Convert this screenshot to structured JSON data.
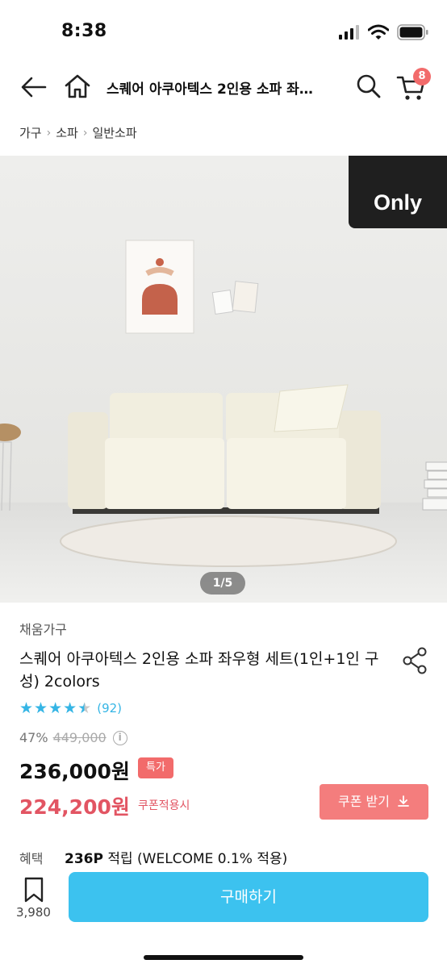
{
  "status": {
    "time": "8:38"
  },
  "header": {
    "title": "스퀘어 아쿠아텍스 2인용 소파 좌…",
    "cart_count": "8"
  },
  "breadcrumb": [
    "가구",
    "소파",
    "일반소파"
  ],
  "hero": {
    "badge": "Only",
    "counter": "1/5",
    "current_image": 1,
    "total_images": 5
  },
  "product": {
    "seller": "채움가구",
    "title": "스퀘어 아쿠아텍스 2인용 소파 좌우형 세트(1인+1인 구성) 2colors",
    "rating": 4.5,
    "review_count": "(92)",
    "discount_rate": "47%",
    "original_price": "449,000",
    "info_icon": "i",
    "price": "236,000원",
    "special_badge": "특가",
    "coupon_price": "224,200원",
    "coupon_note": "쿠폰적용시",
    "coupon_button": "쿠폰 받기"
  },
  "benefit": {
    "label": "혜택",
    "points": "236P",
    "detail": " 적립 (WELCOME 0.1% 적용)"
  },
  "bottom_bar": {
    "bookmark_count": "3,980",
    "buy_label": "구매하기"
  },
  "colors": {
    "accent_blue": "#3cc2ef",
    "coupon_red": "#f47d7d",
    "price_red": "#e25563",
    "star_blue": "#35b5e5"
  }
}
